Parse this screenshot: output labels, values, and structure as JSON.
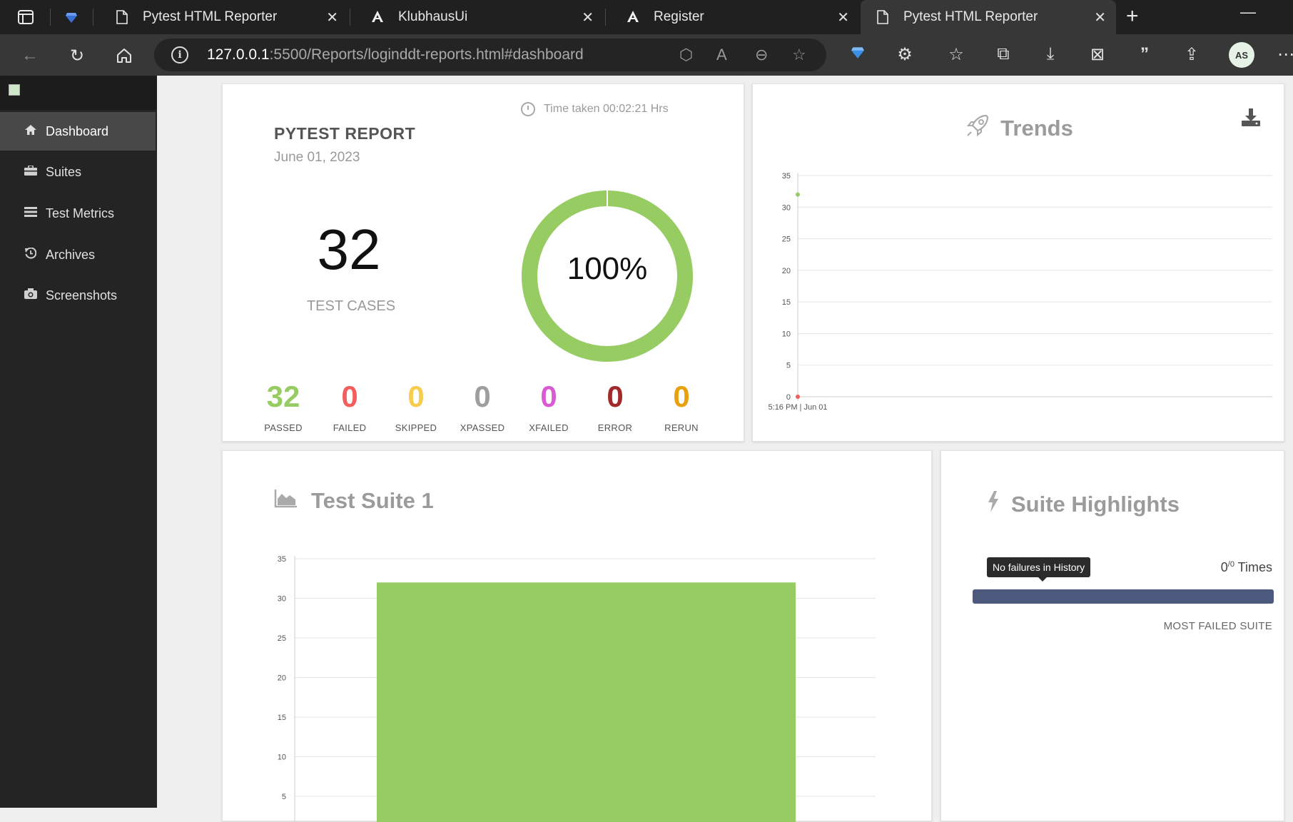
{
  "browser": {
    "tabs": [
      {
        "label": "Pytest HTML Reporter",
        "active": false
      },
      {
        "label": "KlubhausUi",
        "active": false
      },
      {
        "label": "Register",
        "active": false
      },
      {
        "label": "Pytest HTML Reporter",
        "active": true
      }
    ],
    "url_host": "127.0.0.1",
    "url_rest": ":5500/Reports/loginddt-reports.html#dashboard",
    "profile_initials": "AS"
  },
  "sidebar": {
    "items": [
      {
        "label": "Dashboard",
        "icon": "home-icon",
        "active": true
      },
      {
        "label": "Suites",
        "icon": "briefcase-icon",
        "active": false
      },
      {
        "label": "Test Metrics",
        "icon": "list-icon",
        "active": false
      },
      {
        "label": "Archives",
        "icon": "history-icon",
        "active": false
      },
      {
        "label": "Screenshots",
        "icon": "camera-icon",
        "active": false
      }
    ]
  },
  "report": {
    "time_taken": "Time taken 00:02:21 Hrs",
    "title": "PYTEST REPORT",
    "date": "June 01, 2023",
    "total": "32",
    "total_label": "TEST CASES",
    "pass_percent": "100%",
    "pass_fraction": 1.0,
    "stats": [
      {
        "value": "32",
        "label": "PASSED",
        "color": "#96cc62"
      },
      {
        "value": "0",
        "label": "FAILED",
        "color": "#f25d5d"
      },
      {
        "value": "0",
        "label": "SKIPPED",
        "color": "#f7cd4e"
      },
      {
        "value": "0",
        "label": "XPASSED",
        "color": "#9e9e9e"
      },
      {
        "value": "0",
        "label": "XFAILED",
        "color": "#d95bd2"
      },
      {
        "value": "0",
        "label": "ERROR",
        "color": "#a32a2a"
      },
      {
        "value": "0",
        "label": "RERUN",
        "color": "#e8a00c"
      }
    ]
  },
  "trends": {
    "title": "Trends"
  },
  "suite": {
    "title": "Test Suite 1"
  },
  "highlights": {
    "title": "Suite Highlights",
    "tooltip": "No failures in History",
    "times_value": "0",
    "times_sup": "/0",
    "times_word": "Times",
    "most_failed_label": "MOST FAILED SUITE"
  },
  "chart_data": [
    {
      "type": "line",
      "x": [
        "5:16 PM | Jun 01"
      ],
      "series": [
        {
          "values": [
            32
          ],
          "color": "#96cc62"
        },
        {
          "values": [
            0
          ],
          "color": "#f25d5d"
        }
      ],
      "ylim": [
        0,
        35
      ],
      "yticks": [
        0,
        5,
        10,
        15,
        20,
        25,
        30,
        35
      ],
      "grid": true
    },
    {
      "type": "bar",
      "categories": [
        ""
      ],
      "values": [
        32
      ],
      "color": "#96cc62",
      "ylim": [
        0,
        35
      ],
      "yticks": [
        5,
        10,
        15,
        20,
        25,
        30,
        35
      ],
      "grid": true
    }
  ]
}
